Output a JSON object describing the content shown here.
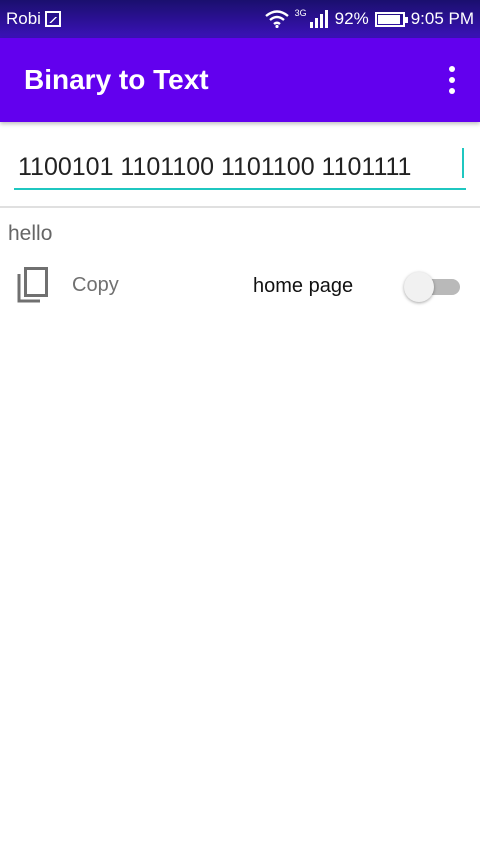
{
  "status_bar": {
    "carrier": "Robi",
    "network": "3G",
    "battery": "92%",
    "battery_level": 0.92,
    "time": "9:05 PM",
    "icons": [
      "image-icon",
      "wifi-icon",
      "signal-icon",
      "battery-icon"
    ]
  },
  "app_bar": {
    "title": "Binary to Text",
    "menu_icon": "overflow-menu-icon"
  },
  "input": {
    "value": "1100101 1101100 1101100 1101111",
    "accent_color": "#1fc7c0"
  },
  "result": {
    "text": "hello"
  },
  "actions": {
    "copy_label": "Copy",
    "home_page_label": "home page",
    "home_page_toggle_on": false
  },
  "colors": {
    "app_bar": "#6200ee",
    "status_bar": "#3b12b8"
  }
}
